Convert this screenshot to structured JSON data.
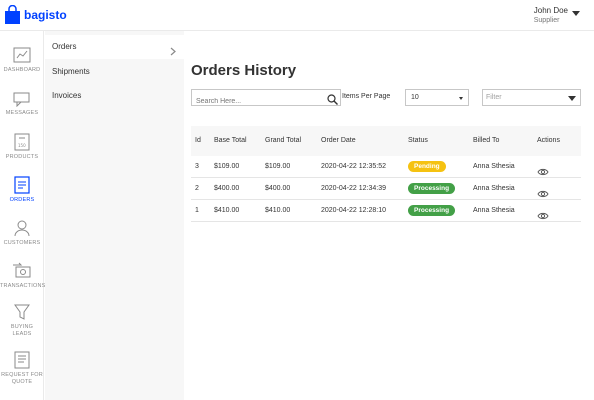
{
  "brand": {
    "name": "bagisto",
    "color": "#0041ff"
  },
  "user": {
    "name": "John Doe",
    "role": "Supplier"
  },
  "iconnav": [
    {
      "label": "Dashboard",
      "icon": "dashboard-icon"
    },
    {
      "label": "Messages",
      "icon": "messages-icon"
    },
    {
      "label": "Products",
      "icon": "products-icon"
    },
    {
      "label": "Orders",
      "icon": "orders-icon",
      "active": true
    },
    {
      "label": "Customers",
      "icon": "customers-icon"
    },
    {
      "label": "Transactions",
      "icon": "transactions-icon"
    },
    {
      "label": "Buying",
      "label2": "Leads",
      "icon": "buying-leads-icon"
    },
    {
      "label": "Request For",
      "label2": "Quote",
      "icon": "request-quote-icon"
    }
  ],
  "subnav": [
    {
      "label": "Orders",
      "active": true
    },
    {
      "label": "Shipments"
    },
    {
      "label": "Invoices"
    }
  ],
  "page": {
    "title": "Orders History",
    "search_placeholder": "Search Here...",
    "items_per_page_label": "Items Per Page",
    "items_per_page_value": "10",
    "filter_placeholder": "Filter"
  },
  "table": {
    "columns": [
      "Id",
      "Base Total",
      "Grand Total",
      "Order Date",
      "Status",
      "Billed To",
      "Actions"
    ],
    "rows": [
      {
        "id": "3",
        "base_total": "$109.00",
        "grand_total": "$109.00",
        "order_date": "2020-04-22 12:35:52",
        "status": "Pending",
        "billed_to": "Anna Sthesia"
      },
      {
        "id": "2",
        "base_total": "$400.00",
        "grand_total": "$400.00",
        "order_date": "2020-04-22 12:34:39",
        "status": "Processing",
        "billed_to": "Anna Sthesia"
      },
      {
        "id": "1",
        "base_total": "$410.00",
        "grand_total": "$410.00",
        "order_date": "2020-04-22 12:28:10",
        "status": "Processing",
        "billed_to": "Anna Sthesia"
      }
    ]
  },
  "colors": {
    "pending": "#f5c211",
    "processing": "#43a047",
    "accent": "#0041ff"
  }
}
